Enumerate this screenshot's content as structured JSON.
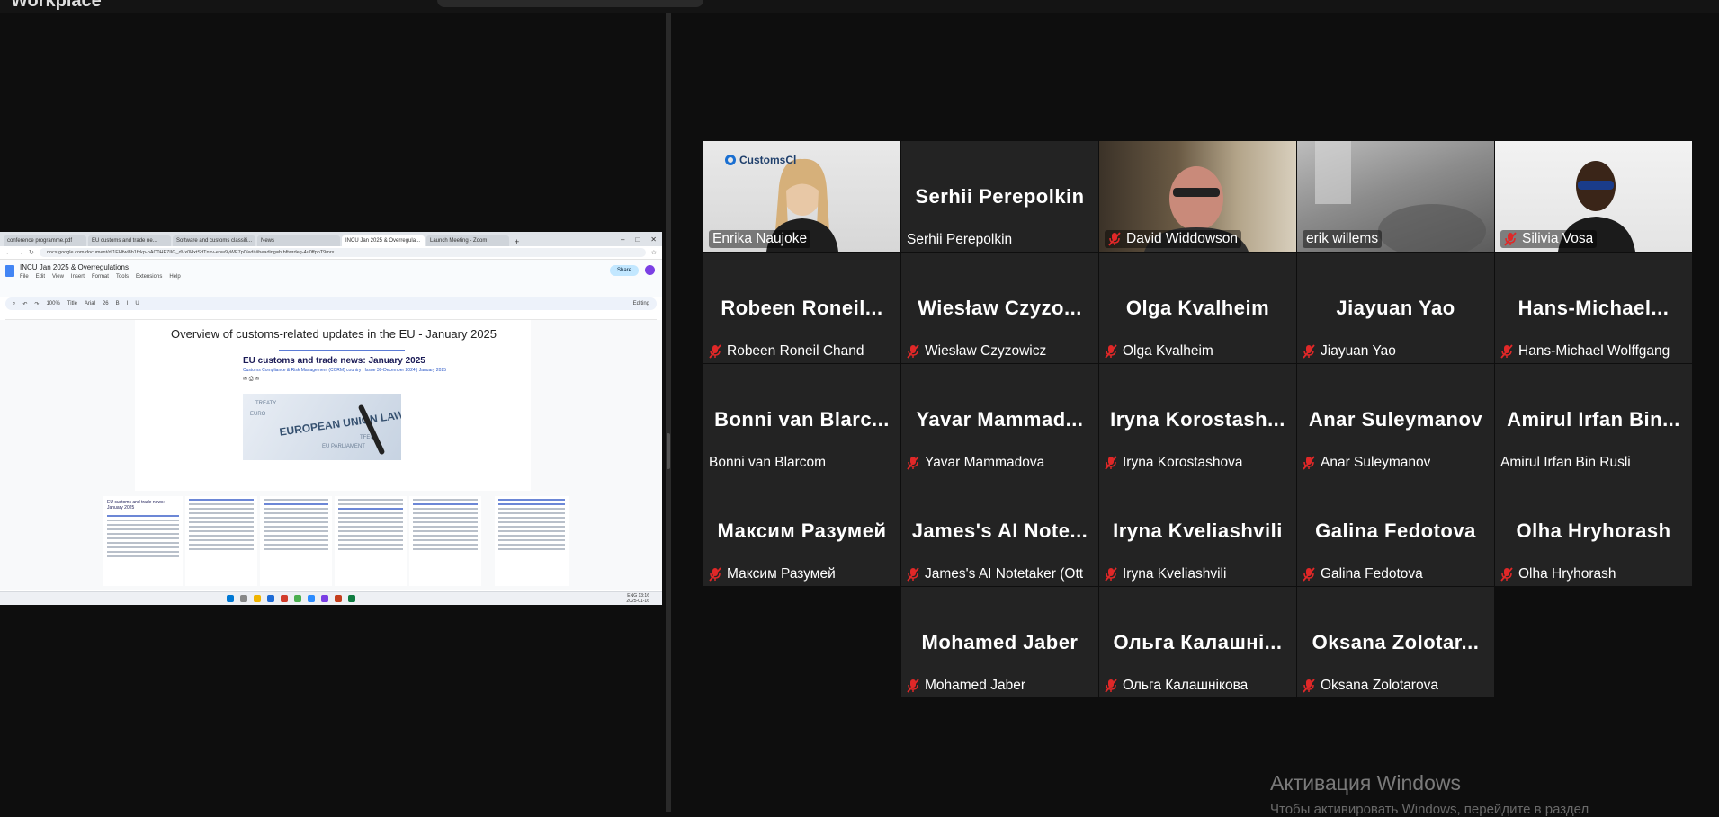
{
  "app": {
    "title": "Workplace"
  },
  "shared_screen": {
    "tabs": [
      {
        "label": "conference programme.pdf"
      },
      {
        "label": "EU customs and trade ne..."
      },
      {
        "label": "Software and customs classifi..."
      },
      {
        "label": "News"
      },
      {
        "label": "INCU Jan 2025 & Overregula..."
      },
      {
        "label": "Launch Meeting - Zoom"
      }
    ],
    "url": "docs.google.com/document/d/1EHfwl8h1fxkp-bAC0HE7IIG_dVx0HxtSdTnxv-enw9yWE7p0/edit#heading=h.bftwrdeg-4u0ffpoT9mrx",
    "doc_title": "INCU Jan 2025 & Overregulations",
    "doc_menu": [
      "File",
      "Edit",
      "View",
      "Insert",
      "Format",
      "Tools",
      "Extensions",
      "Help"
    ],
    "share_label": "Share",
    "toolbar": {
      "zoom": "100%",
      "style": "Title",
      "font": "Arial",
      "size": "26",
      "mode": "Editing"
    },
    "heading": "Overview of customs-related updates in the EU - January 2025",
    "subheading": "EU customs and trade news: January 2025",
    "byline": "Customs Compliance & Risk Management (CCRM) country | Issue 30-December 2024 | January 2025",
    "image_words": [
      "TREATY",
      "EURO",
      "EUROPEAN UNION LAW",
      "EU PARLIAMENT",
      "TFEU"
    ],
    "thumb_title": "EU customs and trade news: January 2025",
    "clock": {
      "time": "13:16",
      "date": "2025-01-16",
      "lang": "ENG"
    }
  },
  "participants": [
    {
      "name": "Enrika Naujoke",
      "video": true,
      "muted": false,
      "speaking": true,
      "logo": "CustomsCl"
    },
    {
      "name": "Serhii Perepolkin",
      "display": "Serhii Perepolkin",
      "video": false,
      "muted": false
    },
    {
      "name": "David Widdowson",
      "video": true,
      "muted": true
    },
    {
      "name": "erik willems",
      "video": true,
      "muted": false
    },
    {
      "name": "Silivia Vosa",
      "video": true,
      "muted": true
    },
    {
      "name": "Robeen Roneil Chand",
      "display": "Robeen Roneil...",
      "muted": true
    },
    {
      "name": "Wiesław Czyzowicz",
      "display": "Wiesław Czyzo...",
      "muted": true
    },
    {
      "name": "Olga Kvalheim",
      "display": "Olga Kvalheim",
      "muted": true
    },
    {
      "name": "Jiayuan Yao",
      "display": "Jiayuan Yao",
      "muted": true
    },
    {
      "name": "Hans-Michael Wolffgang",
      "display": "Hans-Michael...",
      "muted": true
    },
    {
      "name": "Bonni van Blarcom",
      "display": "Bonni van Blarc...",
      "muted": false
    },
    {
      "name": "Yavar Mammadova",
      "display": "Yavar Mammad...",
      "muted": true
    },
    {
      "name": "Iryna Korostashova",
      "display": "Iryna Korostash...",
      "muted": true
    },
    {
      "name": "Anar Suleymanov",
      "display": "Anar Suleymanov",
      "muted": true
    },
    {
      "name": "Amirul Irfan Bin Rusli",
      "display": "Amirul Irfan Bin...",
      "muted": false
    },
    {
      "name": "Максим Разумей",
      "display": "Максим Разумей",
      "muted": true
    },
    {
      "name": "James's AI Notetaker (Ott",
      "display": "James's AI Note...",
      "muted": true
    },
    {
      "name": "Iryna Kveliashvili",
      "display": "Iryna Kveliashvili",
      "muted": true
    },
    {
      "name": "Galina Fedotova",
      "display": "Galina Fedotova",
      "muted": true
    },
    {
      "name": "Olha Hryhorash",
      "display": "Olha Hryhorash",
      "muted": true
    },
    {
      "name": "Mohamed Jaber",
      "display": "Mohamed Jaber",
      "muted": true
    },
    {
      "name": "Ольга Калашнікова",
      "display": "Ольга Калашні...",
      "muted": true
    },
    {
      "name": "Oksana Zolotarova",
      "display": "Oksana Zolotar...",
      "muted": true
    }
  ],
  "watermark": {
    "line1": "Активация Windows",
    "line2": "Чтобы активировать Windows, перейдите в раздел"
  },
  "colors": {
    "active_speaker": "#23d18b",
    "mute": "#e02828",
    "tile": "#232323"
  }
}
